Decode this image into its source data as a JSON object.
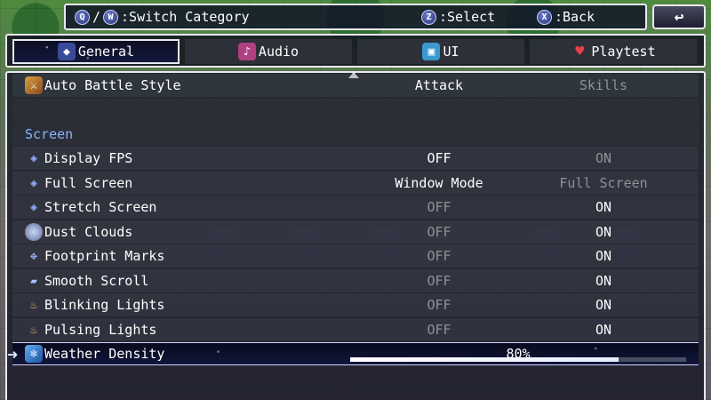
{
  "help_bar": {
    "switch_key1": "Q",
    "separator": "/",
    "switch_key2": "W",
    "switch_label": ":Switch Category",
    "select_key": "Z",
    "select_label": ":Select",
    "back_key": "X",
    "back_label": ":Back"
  },
  "back_button": {
    "icon": "return-arrow-icon",
    "glyph": "↩"
  },
  "tabs": [
    {
      "label": "General",
      "icon": "general-icon",
      "active": true
    },
    {
      "label": "Audio",
      "icon": "audio-icon",
      "active": false
    },
    {
      "label": "UI",
      "icon": "ui-icon",
      "active": false
    },
    {
      "label": "Playtest",
      "icon": "heart-icon",
      "active": false
    }
  ],
  "options": {
    "auto_battle": {
      "label": "Auto Battle Style",
      "opt1": "Attack",
      "opt2": "Skills",
      "selected": "Attack"
    },
    "section_screen": "Screen",
    "display_fps": {
      "label": "Display FPS",
      "opt1": "OFF",
      "opt2": "ON",
      "selected": "OFF"
    },
    "full_screen": {
      "label": "Full Screen",
      "opt1": "Window Mode",
      "opt2": "Full Screen",
      "selected": "Window Mode"
    },
    "stretch_screen": {
      "label": "Stretch Screen",
      "opt1": "OFF",
      "opt2": "ON",
      "selected": "ON"
    },
    "dust_clouds": {
      "label": "Dust Clouds",
      "opt1": "OFF",
      "opt2": "ON",
      "selected": "ON"
    },
    "footprint_marks": {
      "label": "Footprint Marks",
      "opt1": "OFF",
      "opt2": "ON",
      "selected": "ON"
    },
    "smooth_scroll": {
      "label": "Smooth Scroll",
      "opt1": "OFF",
      "opt2": "ON",
      "selected": "ON"
    },
    "blinking_lights": {
      "label": "Blinking Lights",
      "opt1": "OFF",
      "opt2": "ON",
      "selected": "ON"
    },
    "pulsing_lights": {
      "label": "Pulsing Lights",
      "opt1": "OFF",
      "opt2": "ON",
      "selected": "ON"
    },
    "weather_density": {
      "label": "Weather Density",
      "value_text": "80%",
      "value": 0.8
    }
  },
  "colors": {
    "section_header": "#8ab4ff",
    "dim_text": "#8f9296",
    "active_text": "#ffffff"
  }
}
